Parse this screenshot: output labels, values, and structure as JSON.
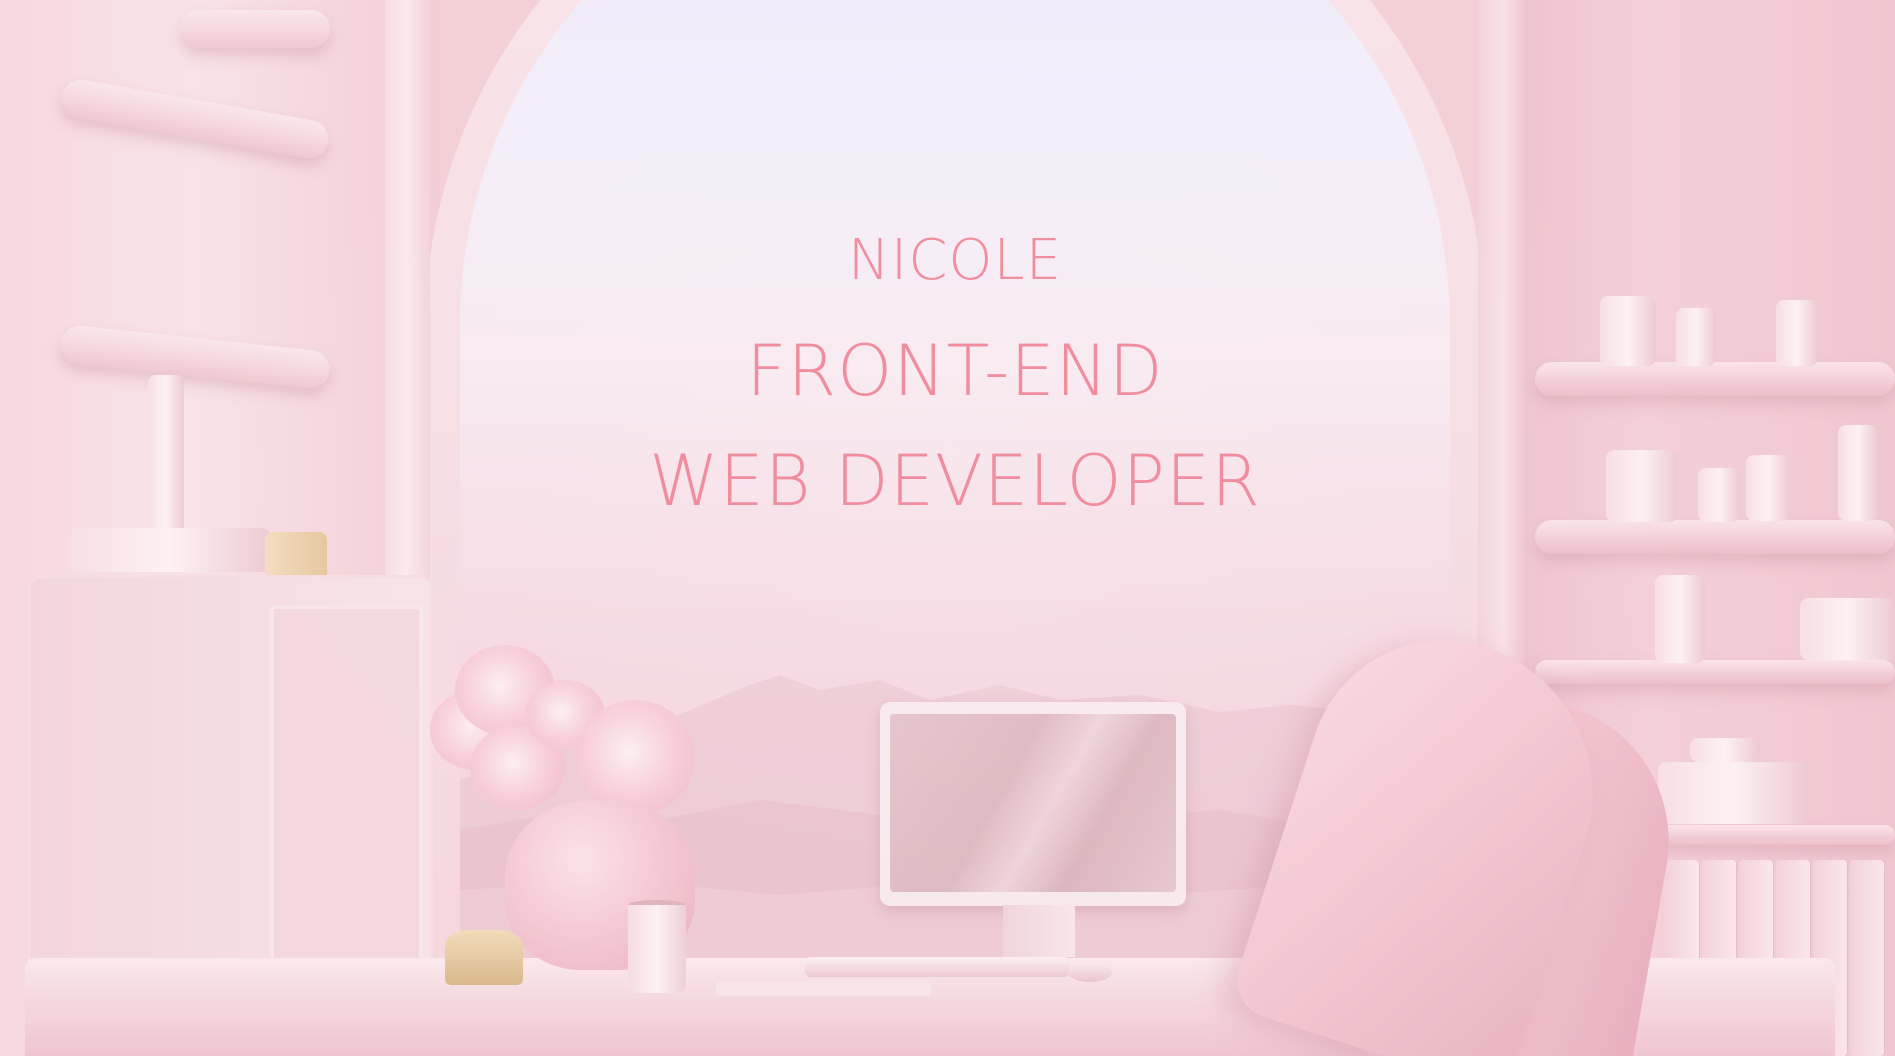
{
  "hero": {
    "name": "NICOLE",
    "role_line1": "FRONT-END",
    "role_line2": "WEB DEVELOPER"
  },
  "colors": {
    "accent_text": "#f08ea0",
    "background": "#f3cfd6"
  }
}
